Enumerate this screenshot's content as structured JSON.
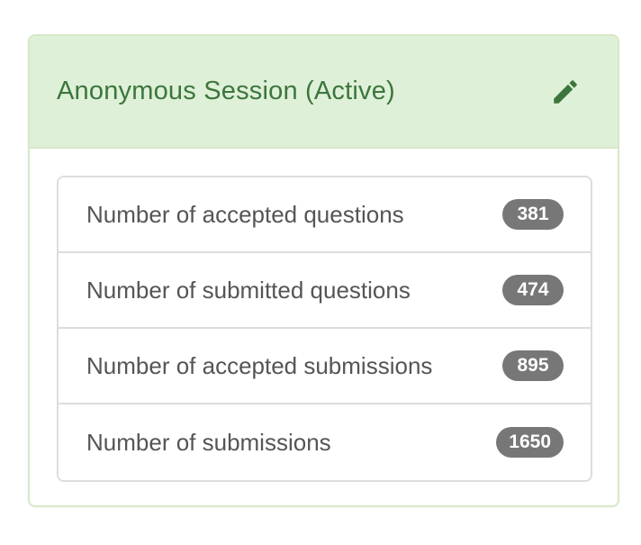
{
  "session": {
    "title": "Anonymous Session (Active)",
    "edit_icon": "pencil-icon"
  },
  "stats": [
    {
      "label": "Number of accepted questions",
      "count": "381"
    },
    {
      "label": "Number of submitted questions",
      "count": "474"
    },
    {
      "label": "Number of accepted submissions",
      "count": "895"
    },
    {
      "label": "Number of submissions",
      "count": "1650"
    }
  ],
  "colors": {
    "heading_bg": "#dff0d8",
    "heading_text": "#3c763d",
    "border": "#d6e9c6",
    "badge_bg": "#777777"
  }
}
